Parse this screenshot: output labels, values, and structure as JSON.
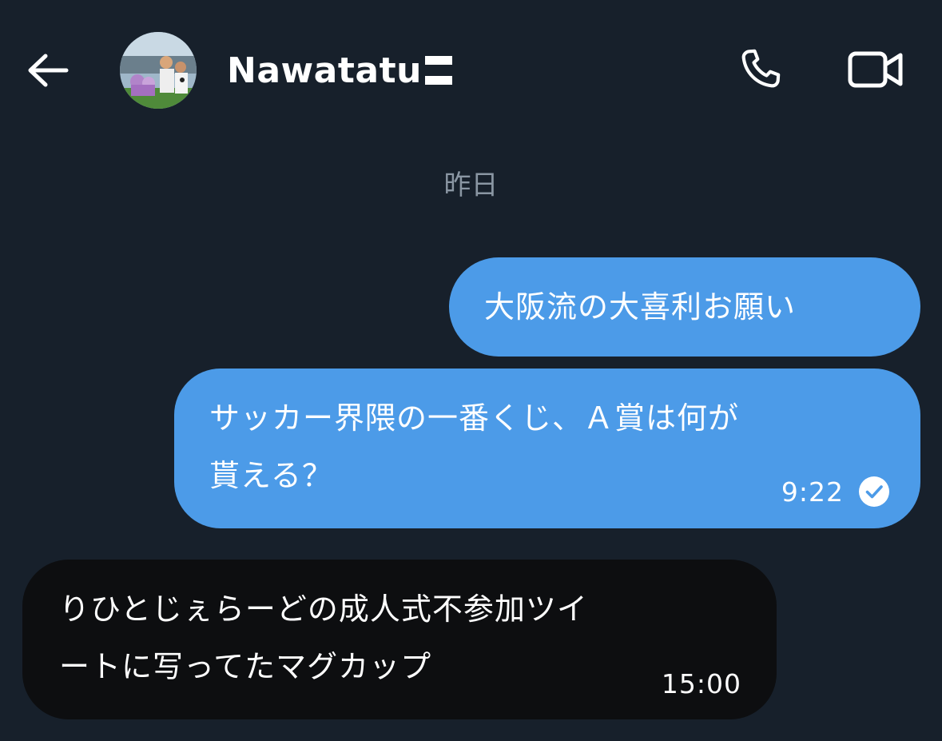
{
  "header": {
    "contact_name": "Nawatatu"
  },
  "date_separator": "昨日",
  "messages": [
    {
      "direction": "outgoing",
      "text": "大阪流の大喜利お願い"
    },
    {
      "direction": "outgoing",
      "text": "サッカー界隈の一番くじ、Ａ賞は何が\n貰える？",
      "time": "9:22",
      "status": "read"
    },
    {
      "direction": "incoming",
      "text": "りひとじぇらーどの成人式不参加ツイ\nートに写ってたマグカップ",
      "time": "15:00"
    }
  ],
  "icons": {
    "back": "arrow-left-icon",
    "call": "phone-icon",
    "video": "video-camera-icon",
    "read_receipt": "check-circle-icon"
  },
  "colors": {
    "background": "#17202b",
    "outgoing_bubble": "#4c9be8",
    "incoming_bubble": "#0d0e10",
    "muted_text": "#8a96a3"
  }
}
